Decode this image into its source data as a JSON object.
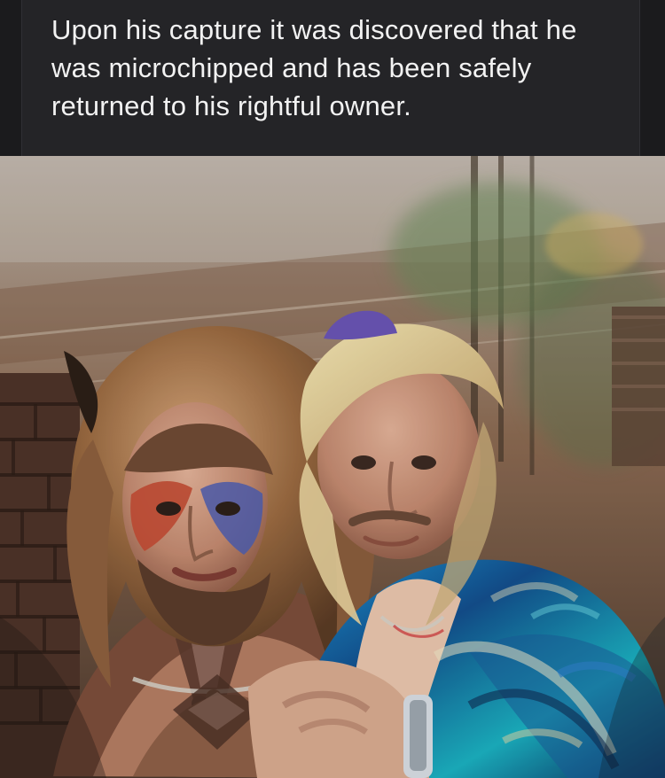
{
  "caption": {
    "text": "Upon his capture it was discovered that he was microchipped and has been safely returned to his rightful owner."
  },
  "photo": {
    "alt": "Two men posing together"
  },
  "colors": {
    "caption_background": "#242427",
    "caption_text": "#f2f2f2",
    "page_background": "#1b1b1d"
  }
}
